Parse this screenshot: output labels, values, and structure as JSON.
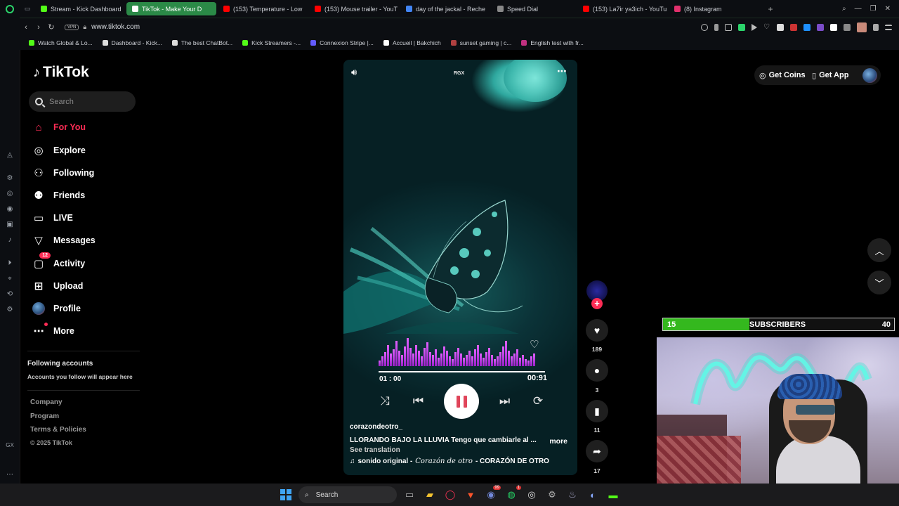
{
  "browser": {
    "tabs": [
      {
        "label": "Stream - Kick Dashboard",
        "color": "#53fc18",
        "active": false
      },
      {
        "label": "TikTok - Make Your D",
        "color": "#ffffff",
        "active": true
      },
      {
        "label": "(153) Temperature - Low",
        "color": "#ff0000",
        "active": false
      },
      {
        "label": "(153) Mouse trailer - YouT",
        "color": "#ff0000",
        "active": false
      },
      {
        "label": "day of the jackal - Reche",
        "color": "#4285f4",
        "active": false
      },
      {
        "label": "Speed Dial",
        "color": "#888888",
        "active": false
      },
      {
        "label": "(153) La7ir ya3ich - YouTu",
        "color": "#ff0000",
        "active": false
      },
      {
        "label": "(8) Instagram",
        "color": "#e1306c",
        "active": false
      }
    ],
    "vpn_label": "VPN",
    "url": "www.tiktok.com",
    "bookmarks": [
      {
        "label": "Watch Global & Lo...",
        "color": "#53fc18"
      },
      {
        "label": "Dashboard - Kick...",
        "color": "#dddddd"
      },
      {
        "label": "The best ChatBot...",
        "color": "#dddddd"
      },
      {
        "label": "Kick Streamers -...",
        "color": "#53fc18"
      },
      {
        "label": "Connexion Stripe |...",
        "color": "#635bff"
      },
      {
        "label": "Accueil | Bakchich",
        "color": "#ffffff"
      },
      {
        "label": "sunset gaming | c...",
        "color": "#b04040"
      },
      {
        "label": "English test with fr...",
        "color": "#c03080"
      }
    ]
  },
  "tiktok": {
    "brand": "TikTok",
    "search_placeholder": "Search",
    "nav": [
      {
        "label": "For You",
        "icon": "home-icon",
        "active": true
      },
      {
        "label": "Explore",
        "icon": "compass-icon"
      },
      {
        "label": "Following",
        "icon": "user-plus-icon"
      },
      {
        "label": "Friends",
        "icon": "friends-icon"
      },
      {
        "label": "LIVE",
        "icon": "live-icon"
      },
      {
        "label": "Messages",
        "icon": "messages-icon"
      },
      {
        "label": "Activity",
        "icon": "activity-icon",
        "badge": "12"
      },
      {
        "label": "Upload",
        "icon": "upload-icon"
      },
      {
        "label": "Profile",
        "icon": "profile-avatar"
      },
      {
        "label": "More",
        "icon": "more-dots-icon"
      }
    ],
    "following_title": "Following accounts",
    "following_sub": "Accounts you follow will appear here",
    "footer": [
      "Company",
      "Program",
      "Terms & Policies"
    ],
    "copyright": "© 2025 TikTok",
    "header": {
      "coins": "Get Coins",
      "app": "Get App"
    },
    "accent": "#fe2c55"
  },
  "video": {
    "watermark": "RGX",
    "time_start": "01 : 00",
    "time_end": "00:91",
    "author": "corazondeotro_",
    "caption": "LLORANDO BAJO LA LLUVIA Tengo que cambiarle al ...",
    "more": "more",
    "see_translation": "See translation",
    "sound_prefix": "sonido original - ",
    "sound_script": "Corazón de otro",
    "sound_suffix": " - CORAZÓN DE OTRO",
    "likes": "189",
    "comments": "3",
    "saves": "11",
    "shares": "17"
  },
  "stream_overlay": {
    "current": "15",
    "label": "SUBSCRIBERS",
    "goal": "40",
    "progress": 0.375
  },
  "taskbar": {
    "search_label": "Search"
  }
}
